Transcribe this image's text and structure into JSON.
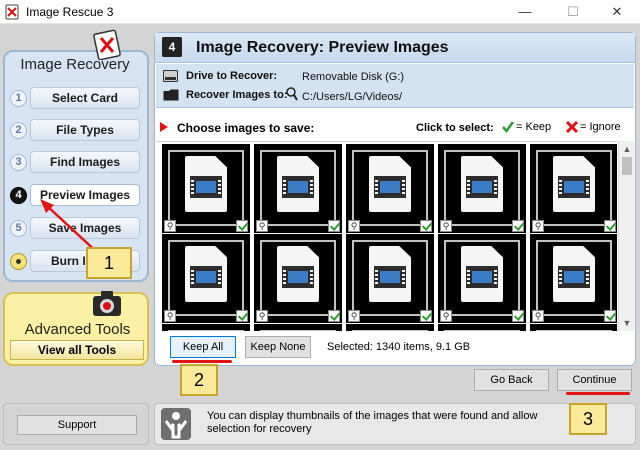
{
  "window": {
    "title": "Image Rescue 3"
  },
  "sidebar": {
    "title": "Image Recovery",
    "steps": [
      {
        "num": "1",
        "label": "Select Card"
      },
      {
        "num": "2",
        "label": "File Types"
      },
      {
        "num": "3",
        "label": "Find Images"
      },
      {
        "num": "4",
        "label": "Preview Images"
      },
      {
        "num": "5",
        "label": "Save Images"
      },
      {
        "num": "",
        "label": "Burn I"
      }
    ],
    "advanced_title": "Advanced Tools",
    "advanced_button": "View all Tools"
  },
  "main": {
    "step_badge": "4",
    "title": "Image Recovery: Preview Images",
    "drive_label": "Drive to Recover:",
    "drive_value": "Removable Disk (G:)",
    "recover_label": "Recover Images to:",
    "recover_value": "C:/Users/LG/Videos/",
    "choose_label": "Choose images to save:",
    "click_to_select": "Click to select:",
    "keep_legend": "= Keep",
    "ignore_legend": "= Ignore",
    "keep_all": "Keep All",
    "keep_none": "Keep None",
    "selected_info": "Selected: 1340 items, 9.1 GB"
  },
  "nav": {
    "go_back": "Go Back",
    "continue": "Continue"
  },
  "footer": {
    "support": "Support",
    "tip": "You can display thumbnails of the images that were found and allow selection for recovery"
  },
  "annotations": [
    "1",
    "2",
    "3"
  ],
  "colors": {
    "accent_red": "#e01414",
    "keep_green": "#2f9b2f",
    "note_yellow": "#fde99a"
  }
}
